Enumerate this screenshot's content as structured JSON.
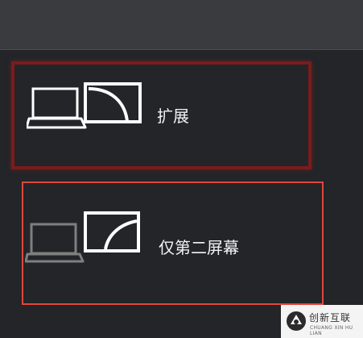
{
  "panel": {
    "options": [
      {
        "label": "扩展",
        "icon": "extend-display-icon"
      },
      {
        "label": "仅第二屏幕",
        "icon": "second-screen-only-icon"
      }
    ]
  },
  "highlight_colors": {
    "extend_outline": "#7a1c1c",
    "second_screen_outline": "#e0463e"
  },
  "watermark": {
    "name": "创新互联",
    "sub": "CHUANG XIN HU LIAN",
    "icon": "brand-logo-icon"
  }
}
